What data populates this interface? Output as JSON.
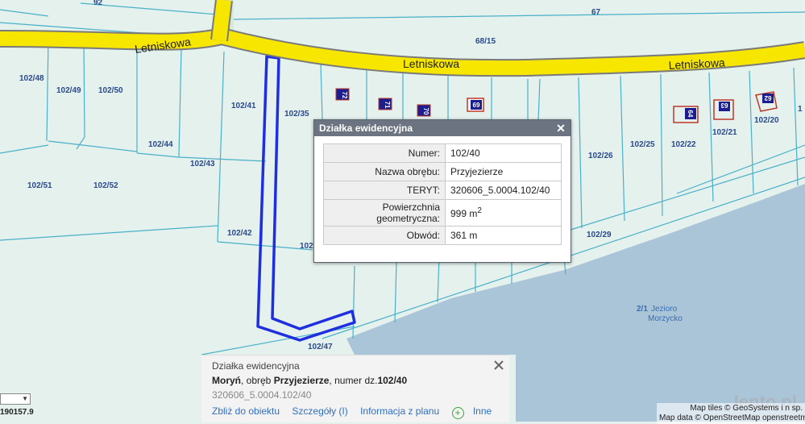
{
  "map": {
    "streets": [
      "Letniskowa",
      "Letniskowa",
      "Letniskowa"
    ],
    "parcels": [
      "92",
      "67",
      "68/15",
      "102/48",
      "102/49",
      "102/50",
      "102/41",
      "102/35",
      "72",
      "71",
      "70",
      "69",
      "102/44",
      "102/43",
      "102/51",
      "102/52",
      "102/42",
      "102",
      "102/26",
      "102/25",
      "102/22",
      "102/21",
      "102/20",
      "64",
      "63",
      "62",
      "102/29",
      "102/47",
      "1"
    ],
    "lake_id": "2/1",
    "lake_name": [
      "Jezioro",
      "Morzycko"
    ]
  },
  "popup": {
    "title": "Działka ewidencyjna",
    "close": "✕",
    "rows": [
      {
        "key": "Numer:",
        "value": "102/40"
      },
      {
        "key": "Nazwa obrębu:",
        "value": "Przyjezierze"
      },
      {
        "key": "TERYT:",
        "value": "320606_5.0004.102/40"
      },
      {
        "key": "Powierzchnia geometryczna:",
        "value": "999 m",
        "sup": "2"
      },
      {
        "key": "Obwód:",
        "value": "361 m"
      }
    ]
  },
  "panel": {
    "title": "Działka ewidencyjna",
    "town": "Moryń",
    "sep1": ", obręb ",
    "area": "Przyjezierze",
    "sep2": ", numer dz.",
    "number": "102/40",
    "teryt": "320606_5.0004.102/40",
    "links": [
      "Zbliż do obiektu",
      "Szczegóły (I)",
      "Informacja z planu",
      "Inne"
    ]
  },
  "coord": "190157.9",
  "attribution": [
    "Map tiles © GeoSystems i n sp.",
    "Map data © OpenStreetMap openstreetmap.org/c"
  ],
  "watermark": "lento.pl",
  "colors": {
    "road": "#f7e600",
    "road_edge": "#7a7a7a",
    "parcel_line": "#4ab0c9",
    "selection": "#1f2fe0",
    "lake": "#aac4d8",
    "land": "#e4f1ec"
  }
}
